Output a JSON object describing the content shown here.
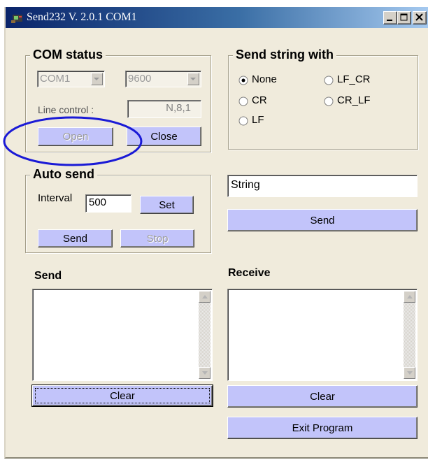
{
  "window": {
    "title": "Send232  V. 2.0.1  COM1",
    "titlebar_color": "#0a246a",
    "client_color": "#f0ebdc",
    "button_color": "#c2c4fa"
  },
  "com_status": {
    "title": "COM status",
    "port_value": "COM1",
    "baud_value": "9600",
    "line_control_label": "Line control :",
    "line_control_value": "N,8,1",
    "open_label": "Open",
    "close_label": "Close"
  },
  "send_string_with": {
    "title": "Send string with",
    "options": [
      {
        "label": "None",
        "selected": true
      },
      {
        "label": "LF_CR",
        "selected": false
      },
      {
        "label": "CR",
        "selected": false
      },
      {
        "label": "CR_LF",
        "selected": false
      },
      {
        "label": "LF",
        "selected": false
      }
    ]
  },
  "auto_send": {
    "title": "Auto send",
    "interval_label": "Interval",
    "interval_value": "500",
    "set_label": "Set",
    "send_label": "Send",
    "stop_label": "Stop"
  },
  "string_send": {
    "string_value": "String",
    "send_label": "Send"
  },
  "send_panel": {
    "title": "Send",
    "clear_label": "Clear"
  },
  "receive_panel": {
    "title": "Receive",
    "clear_label": "Clear"
  },
  "exit_label": "Exit Program",
  "annotation": {
    "color": "#1a1ad6",
    "highlights": "open-button"
  }
}
